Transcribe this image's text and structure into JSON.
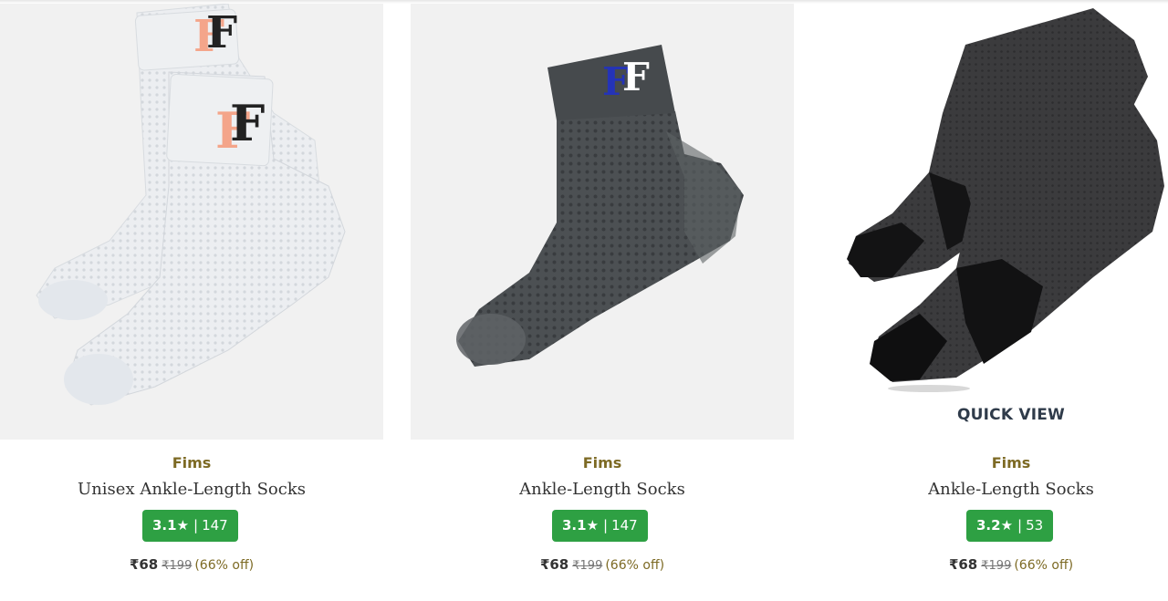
{
  "products": [
    {
      "brand": "Fims",
      "title": "Unisex Ankle-Length Socks",
      "rating": "3.1",
      "star": "★",
      "separator": "|",
      "reviews": "147",
      "price": "₹68",
      "mrp": "₹199",
      "discount": "(66% off)",
      "logo_text": "FF",
      "colors": {
        "sock": "#e9ecef",
        "logo_a": "#f4a58a",
        "logo_b": "#222222"
      }
    },
    {
      "brand": "Fims",
      "title": "Ankle-Length Socks",
      "rating": "3.1",
      "star": "★",
      "separator": "|",
      "reviews": "147",
      "price": "₹68",
      "mrp": "₹199",
      "discount": "(66% off)",
      "logo_text": "FF",
      "colors": {
        "sock": "#4a4d50",
        "logo_a": "#2433b8",
        "logo_b": "#ffffff"
      }
    },
    {
      "brand": "Fims",
      "title": "Ankle-Length Socks",
      "rating": "3.2",
      "star": "★",
      "separator": "|",
      "reviews": "53",
      "price": "₹68",
      "mrp": "₹199",
      "discount": "(66% off)",
      "quick_view": "QUICK VIEW",
      "colors": {
        "sock": "#3a3a3c",
        "accent": "#0f0f10"
      }
    }
  ],
  "colors": {
    "rating_bg": "#2ea043",
    "brand_text": "#7d6a24",
    "image_bg": "#f1f1f1"
  }
}
